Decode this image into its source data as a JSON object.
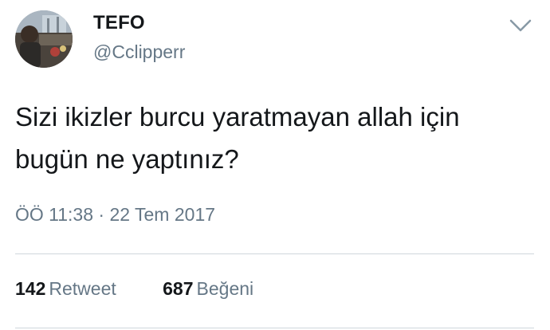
{
  "user": {
    "display_name": "TEFO",
    "handle": "@Cclipperr"
  },
  "tweet": {
    "text_line1": "Sizi ikizler burcu yaratmayan allah için",
    "text_line2": "bugün ne yaptınız?",
    "timestamp": "ÖÖ 11:38 · 22 Tem 2017"
  },
  "stats": {
    "retweet_count": "142",
    "retweet_label": "Retweet",
    "like_count": "687",
    "like_label": "Beğeni"
  },
  "icons": {
    "menu": "chevron-down-icon"
  },
  "colors": {
    "text_primary": "#14171a",
    "text_secondary": "#657786",
    "divider": "#cfd6dc",
    "background": "#ffffff"
  }
}
